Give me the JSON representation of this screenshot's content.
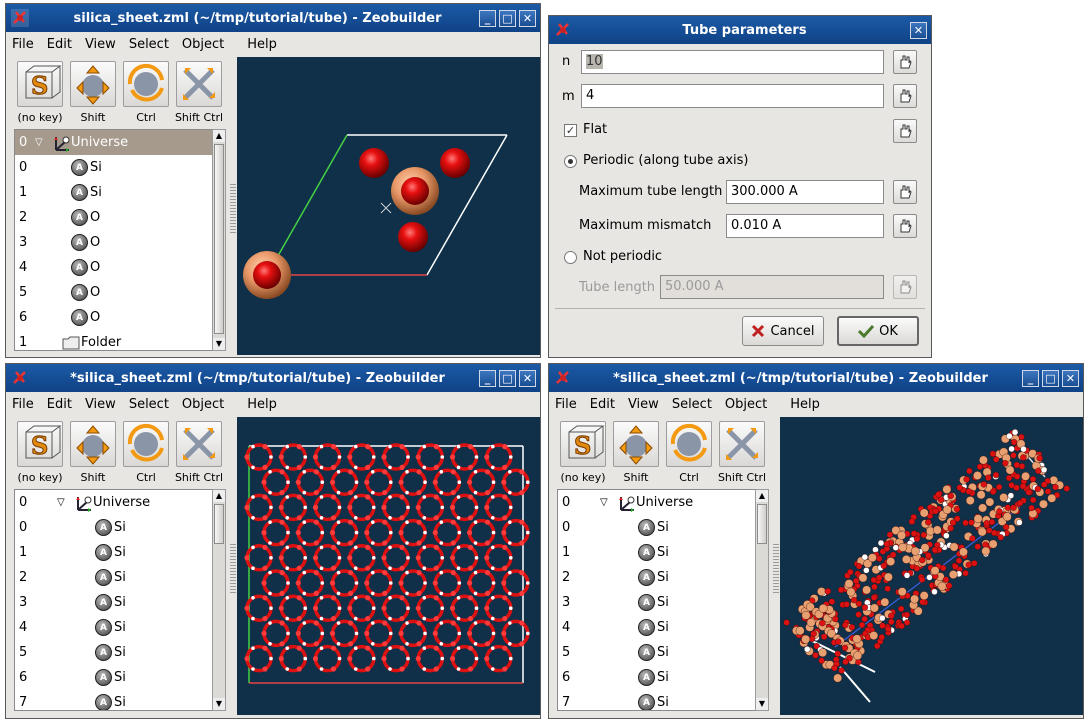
{
  "windows": {
    "w1": {
      "title": "silica_sheet.zml (~/tmp/tutorial/tube) - Zeobuilder"
    },
    "w2": {
      "title": "*silica_sheet.zml (~/tmp/tutorial/tube) - Zeobuilder"
    },
    "w3": {
      "title": "*silica_sheet.zml (~/tmp/tutorial/tube) - Zeobuilder"
    }
  },
  "menu": [
    "File",
    "Edit",
    "View",
    "Select",
    "Object",
    "Help"
  ],
  "tools": [
    "(no key)",
    "Shift",
    "Ctrl",
    "Shift Ctrl"
  ],
  "tree1": [
    {
      "idx": "0",
      "label": "Universe",
      "type": "universe"
    },
    {
      "idx": "0",
      "label": "Si",
      "type": "atom"
    },
    {
      "idx": "1",
      "label": "Si",
      "type": "atom"
    },
    {
      "idx": "2",
      "label": "O",
      "type": "atom"
    },
    {
      "idx": "3",
      "label": "O",
      "type": "atom"
    },
    {
      "idx": "4",
      "label": "O",
      "type": "atom"
    },
    {
      "idx": "5",
      "label": "O",
      "type": "atom"
    },
    {
      "idx": "6",
      "label": "O",
      "type": "atom"
    },
    {
      "idx": "1",
      "label": "Folder",
      "type": "folder"
    }
  ],
  "tree2": [
    {
      "idx": "0",
      "label": "Universe",
      "type": "universe"
    },
    {
      "idx": "0",
      "label": "Si",
      "type": "atom"
    },
    {
      "idx": "1",
      "label": "Si",
      "type": "atom"
    },
    {
      "idx": "2",
      "label": "Si",
      "type": "atom"
    },
    {
      "idx": "3",
      "label": "Si",
      "type": "atom"
    },
    {
      "idx": "4",
      "label": "Si",
      "type": "atom"
    },
    {
      "idx": "5",
      "label": "Si",
      "type": "atom"
    },
    {
      "idx": "6",
      "label": "Si",
      "type": "atom"
    },
    {
      "idx": "7",
      "label": "Si",
      "type": "atom"
    }
  ],
  "dialog": {
    "title": "Tube parameters",
    "n_label": "n",
    "n_value": "10",
    "m_label": "m",
    "m_value": "4",
    "flat_label": "Flat",
    "periodic_label": "Periodic (along tube axis)",
    "max_len_label": "Maximum tube length",
    "max_len_value": "300.000 A",
    "max_mis_label": "Maximum mismatch",
    "max_mis_value": "0.010 A",
    "not_periodic_label": "Not periodic",
    "tube_len_label": "Tube length",
    "tube_len_value": "50.000 A",
    "cancel_label": "Cancel",
    "ok_label": "OK"
  },
  "colors": {
    "titlebar": "#1651a0",
    "viewport_bg": "#0f3048",
    "oxygen": "#dd1111",
    "silicon": "#e8a070",
    "cell_edge": "#ffffff",
    "axis_a": "#e04040",
    "axis_b": "#40d040"
  }
}
